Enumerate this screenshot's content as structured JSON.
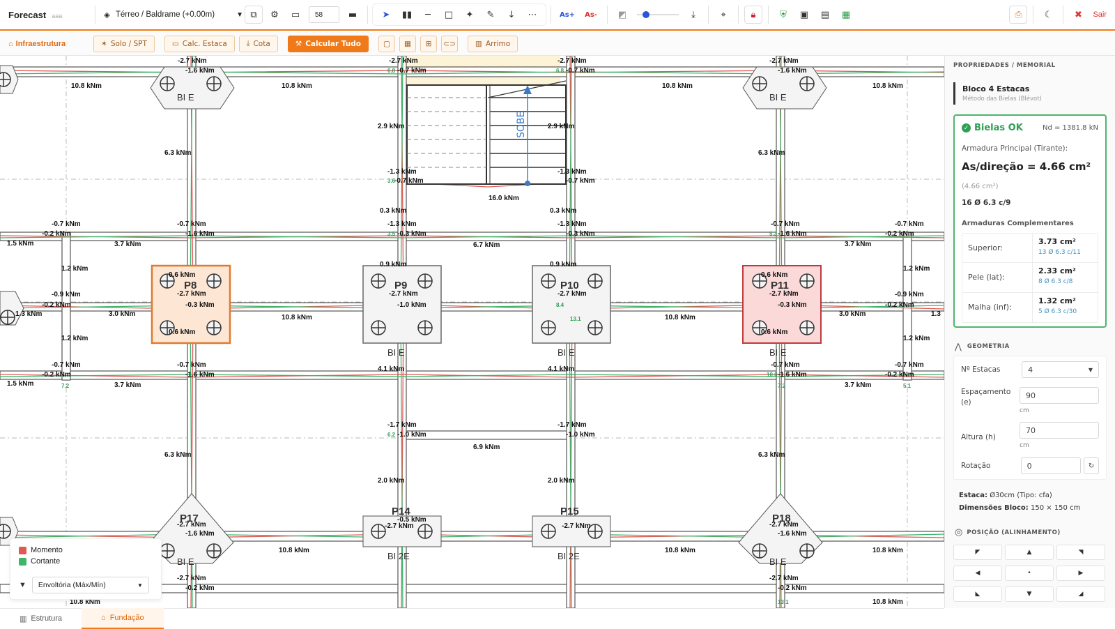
{
  "app": {
    "title": "Forecast",
    "subtitle": "aaa"
  },
  "topbar": {
    "floor_selector": "Térreo / Baldrame (+0.00m)",
    "zoom_value": "58",
    "as_plus": "As+",
    "as_minus": "As-",
    "slider_level": 0.15,
    "exit_label": "Sair"
  },
  "toolbar2": {
    "infra": "Infraestrutura",
    "solo": "Solo / SPT",
    "calc_estaca": "Calc. Estaca",
    "cota": "Cota",
    "calcular": "Calcular Tudo",
    "arrimo": "Arrimo"
  },
  "canvas": {
    "pillars": [
      "P8",
      "P9",
      "P10",
      "P11",
      "P17",
      "P14",
      "P15",
      "P18"
    ],
    "block_labels": {
      "b1": "BI E",
      "b2": "BI 2E"
    },
    "stair_label": "SOBE",
    "moments": {
      "m_m27": "-2.7 kNm",
      "m_m16": "-1.6 kNm",
      "m_m07": "-0.7 kNm",
      "m_m02": "-0.2 kNm",
      "m_108": "10.8 kNm",
      "m_63": "6.3 kNm",
      "m_29": "2.9 kNm",
      "m_m13": "-1.3 kNm",
      "m_03": "0.3 kNm",
      "m_m03": "-0.3 kNm",
      "m_160": "16.0 kNm",
      "m_67": "6.7 kNm",
      "m_15": "1.5 kNm",
      "m_37": "3.7 kNm",
      "m_12": "1.2 kNm",
      "m_06": "0.6 kNm",
      "m_m09": "-0.9 kNm",
      "m_09": "0.9 kNm",
      "m_13": "1.3 kNm",
      "m_30": "3.0 kNm",
      "m_m10": "-1.0 kNm",
      "m_41": "4.1 kNm",
      "m_m17": "-1.7 kNm",
      "m_69": "6.9 kNm",
      "m_20": "2.0 kNm",
      "m_m05": "-0.5 kNm",
      "m_13b": "1.3"
    },
    "shears": {
      "s68": "6.8",
      "s36": "3.6",
      "s35": "3.5",
      "s53": "5.3",
      "s84": "8.4",
      "s131": "13.1",
      "s72": "7.2",
      "s100": "10.0",
      "s51": "5.1",
      "s62": "6.2"
    }
  },
  "legend": {
    "momento": "Momento",
    "cortante": "Cortante",
    "filter": "Envoltória (Máx/Mín)",
    "colors": {
      "momento": "#e05a55",
      "cortante": "#3db56b"
    }
  },
  "bottom": {
    "estrutura": "Estrutura",
    "fundacao": "Fundação"
  },
  "side": {
    "header": "PROPRIEDADES / MEMORIAL",
    "block_title": "Bloco 4 Estacas",
    "block_method": "Método das Bielas (Blévot)",
    "status": "Bielas OK",
    "nd": "Nd = 1381.8 kN",
    "arm_principal_label": "Armadura Principal (Tirante):",
    "as_dir": "As/direção = 4.66 cm²",
    "as_dir_paren": "(4.66 cm²)",
    "as_bars": "16 Ø 6.3 c/9",
    "complement_label": "Armaduras Complementares",
    "superior_label": "Superior:",
    "superior_area": "3.73 cm²",
    "superior_bars": "13 Ø 6.3 c/11",
    "pele_label": "Pele (lat):",
    "pele_area": "2.33 cm²",
    "pele_bars": "8 Ø 6.3 c/8",
    "malha_label": "Malha (inf):",
    "malha_area": "1.32 cm²",
    "malha_bars": "5 Ø 6.3 c/30",
    "geometria": "GEOMETRIA",
    "n_estacas_label": "Nº Estacas",
    "n_estacas": "4",
    "espacamento_label": "Espaçamento (e)",
    "espacamento": "90",
    "cm1": "cm",
    "altura_label": "Altura (h)",
    "altura": "70",
    "cm2": "cm",
    "rotacao_label": "Rotação",
    "rotacao": "0",
    "estaca_label": "Estaca:",
    "estaca_val": "Ø30cm (Tipo: cfa)",
    "dim_label": "Dimensões Bloco:",
    "dim_val": "150 × 150 cm",
    "posicao": "POSIÇÃO (ALINHAMENTO)"
  }
}
